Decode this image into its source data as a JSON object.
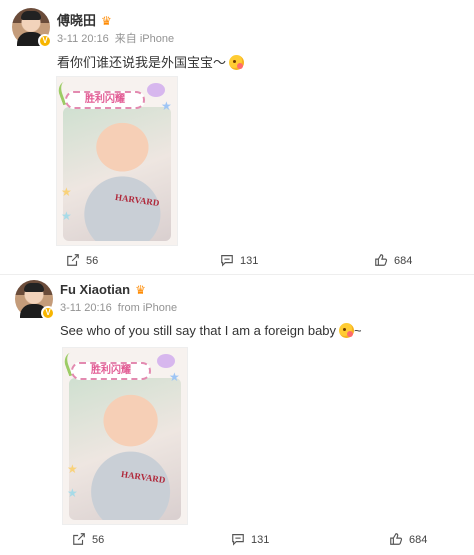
{
  "posts": [
    {
      "name": "傅晓田",
      "time": "3-11 20:16",
      "source": "来自 iPhone",
      "text": "看你们谁还说我是外国宝宝～",
      "photo": {
        "banner": "胜利闪耀",
        "shirt": "HARVARD"
      },
      "actions": {
        "repost": "56",
        "comment": "131",
        "like": "684"
      }
    },
    {
      "name": "Fu Xiaotian",
      "time": "3-11 20:16",
      "source": "from iPhone",
      "text": "See who of you still say that I am a foreign baby",
      "text_suffix": "~",
      "photo": {
        "banner": "胜利闪耀",
        "shirt": "HARVARD"
      },
      "actions": {
        "repost": "56",
        "comment": "131",
        "like": "684"
      }
    }
  ],
  "colors": {
    "meta": "#939393",
    "text": "#333333",
    "crown": "#ff8a00",
    "badge": "#f7b500"
  },
  "icons": [
    "crown-icon",
    "verified-badge-icon",
    "emoji-icon",
    "repost-icon",
    "comment-icon",
    "like-icon"
  ]
}
